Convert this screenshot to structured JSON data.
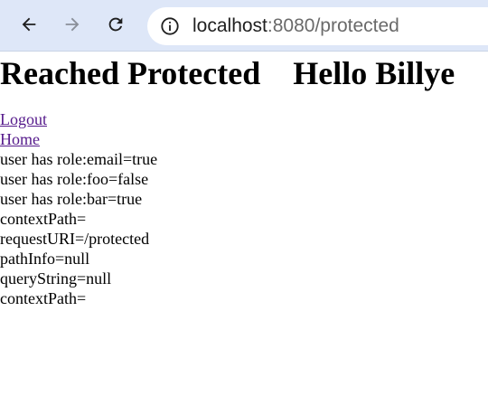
{
  "browser": {
    "url_host": "localhost",
    "url_rest": ":8080/protected"
  },
  "page": {
    "heading": "Reached Protected    Hello Billye",
    "links": [
      {
        "label": "Logout"
      },
      {
        "label": "Home"
      }
    ],
    "lines": [
      "user has role:email=true",
      "user has role:foo=false",
      "user has role:bar=true",
      "contextPath=",
      "requestURI=/protected",
      "pathInfo=null",
      "queryString=null",
      "contextPath="
    ]
  }
}
